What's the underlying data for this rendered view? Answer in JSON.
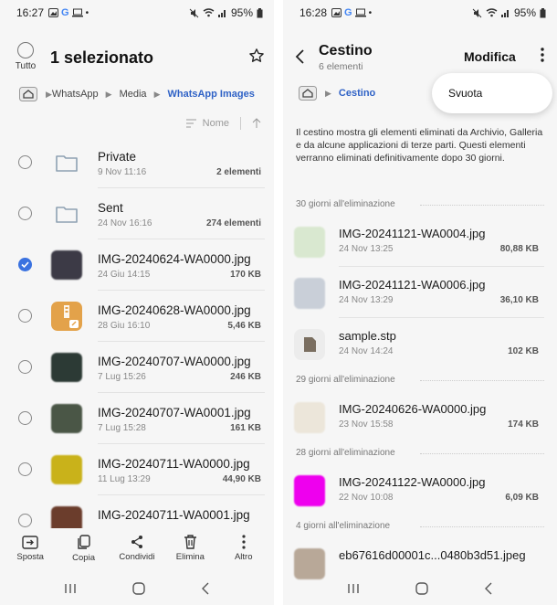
{
  "left": {
    "status": {
      "time": "16:27",
      "battery": "95%"
    },
    "header": {
      "select_all_label": "Tutto",
      "title": "1 selezionato"
    },
    "breadcrumb": [
      "WhatsApp",
      "Media",
      "WhatsApp Images"
    ],
    "sort": {
      "label": "Nome"
    },
    "files": [
      {
        "name": "Private",
        "date": "9 Nov 11:16",
        "size": "2 elementi",
        "kind": "folder",
        "selected": false
      },
      {
        "name": "Sent",
        "date": "24 Nov 16:16",
        "size": "274 elementi",
        "kind": "folder",
        "selected": false
      },
      {
        "name": "IMG-20240624-WA0000.jpg",
        "date": "24 Giu 14:15",
        "size": "170 KB",
        "kind": "image",
        "thumb": "#3c3a46",
        "selected": true
      },
      {
        "name": "IMG-20240628-WA0000.jpg",
        "date": "28 Giu 16:10",
        "size": "5,46 KB",
        "kind": "archive",
        "selected": false
      },
      {
        "name": "IMG-20240707-WA0000.jpg",
        "date": "7 Lug 15:26",
        "size": "246 KB",
        "kind": "image",
        "thumb": "#2c3a35",
        "selected": false
      },
      {
        "name": "IMG-20240707-WA0001.jpg",
        "date": "7 Lug 15:28",
        "size": "161 KB",
        "kind": "image",
        "thumb": "#4a5646",
        "selected": false
      },
      {
        "name": "IMG-20240711-WA0000.jpg",
        "date": "11 Lug 13:29",
        "size": "44,90 KB",
        "kind": "image",
        "thumb": "#c9b21a",
        "selected": false
      },
      {
        "name": "IMG-20240711-WA0001.jpg",
        "date": "",
        "size": "",
        "kind": "image",
        "thumb": "#6b3d2c",
        "selected": false
      }
    ],
    "bottom_actions": [
      "Sposta",
      "Copia",
      "Condividi",
      "Elimina",
      "Altro"
    ]
  },
  "right": {
    "status": {
      "time": "16:28",
      "battery": "95%"
    },
    "header": {
      "title": "Cestino",
      "subtitle": "6 elementi",
      "edit_label": "Modifica"
    },
    "breadcrumb": [
      "Cestino"
    ],
    "popup": {
      "label": "Svuota"
    },
    "info": "Il cestino mostra gli elementi eliminati da Archivio, Galleria e da alcune applicazioni di terze parti. Questi elementi verranno eliminati definitivamente dopo 30 giorni.",
    "groups": [
      {
        "header": "30 giorni all'eliminazione",
        "items": [
          {
            "name": "IMG-20241121-WA0004.jpg",
            "date": "24 Nov 13:25",
            "size": "80,88 KB",
            "thumb": "#d9e8d0"
          },
          {
            "name": "IMG-20241121-WA0006.jpg",
            "date": "24 Nov 13:29",
            "size": "36,10 KB",
            "thumb": "#c9cfd8"
          },
          {
            "name": "sample.stp",
            "date": "24 Nov 14:24",
            "size": "102 KB",
            "thumb": "doc"
          }
        ]
      },
      {
        "header": "29 giorni all'eliminazione",
        "items": [
          {
            "name": "IMG-20240626-WA0000.jpg",
            "date": "23 Nov 15:58",
            "size": "174 KB",
            "thumb": "#ece6da"
          }
        ]
      },
      {
        "header": "28 giorni all'eliminazione",
        "items": [
          {
            "name": "IMG-20241122-WA0000.jpg",
            "date": "22 Nov 10:08",
            "size": "6,09 KB",
            "thumb": "#ee00ee"
          }
        ]
      },
      {
        "header": "4 giorni all'eliminazione",
        "items": [
          {
            "name": "eb67616d00001c...0480b3d51.jpeg",
            "date": "",
            "size": "",
            "thumb": "#b8a898"
          }
        ]
      }
    ]
  },
  "colors": {
    "accent": "#2f62c6",
    "checkbox_on": "#3a72e0",
    "background": "#f6f6f6"
  }
}
